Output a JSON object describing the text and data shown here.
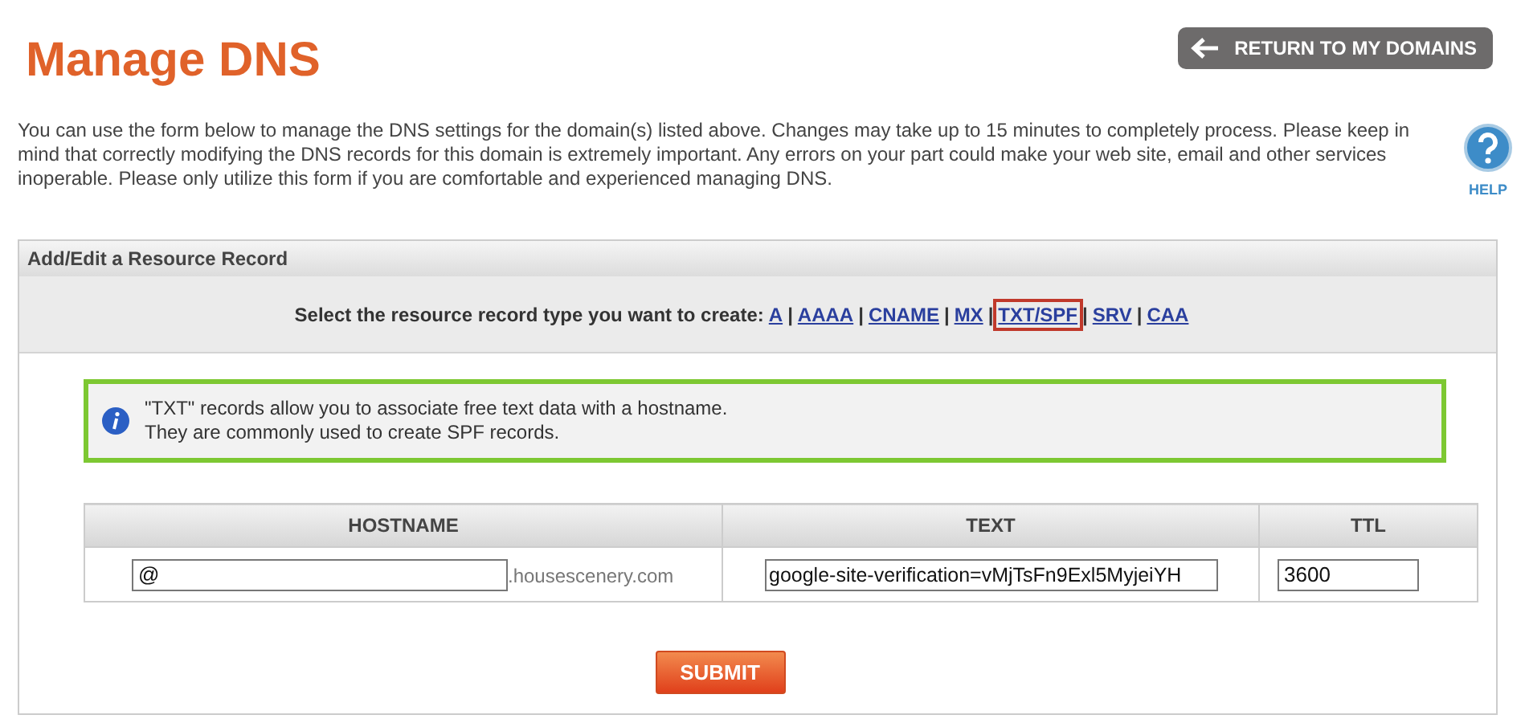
{
  "title": "Manage DNS",
  "return_button": {
    "label": "RETURN TO MY DOMAINS"
  },
  "intro": "You can use the form below to manage the DNS settings for the domain(s) listed above. Changes may take up to 15 minutes to completely process. Please keep in mind that correctly modifying the DNS records for this domain is extremely important. Any errors on your part could make your web site, email and other services inoperable. Please only utilize this form if you are comfortable and experienced managing DNS.",
  "help": {
    "label": "HELP"
  },
  "panel": {
    "title": "Add/Edit a Resource Record",
    "type_prompt": "Select the resource record type you want to create:",
    "type_separator": "|",
    "record_types": [
      {
        "label": "A",
        "selected": false
      },
      {
        "label": "AAAA",
        "selected": false
      },
      {
        "label": "CNAME",
        "selected": false
      },
      {
        "label": "MX",
        "selected": false
      },
      {
        "label": "TXT/SPF",
        "selected": true
      },
      {
        "label": "SRV",
        "selected": false
      },
      {
        "label": "CAA",
        "selected": false
      }
    ],
    "info_lines": [
      "\"TXT\" records allow you to associate free text data with a hostname.",
      "They are commonly used to create SPF records."
    ],
    "table": {
      "columns": [
        "HOSTNAME",
        "TEXT",
        "TTL"
      ],
      "row": {
        "hostname": "@",
        "domain_suffix": ".housescenery.com",
        "text": "google-site-verification=vMjTsFn9Exl5MyjeiYH",
        "ttl": "3600"
      }
    },
    "submit": {
      "label": "SUBMIT"
    }
  }
}
